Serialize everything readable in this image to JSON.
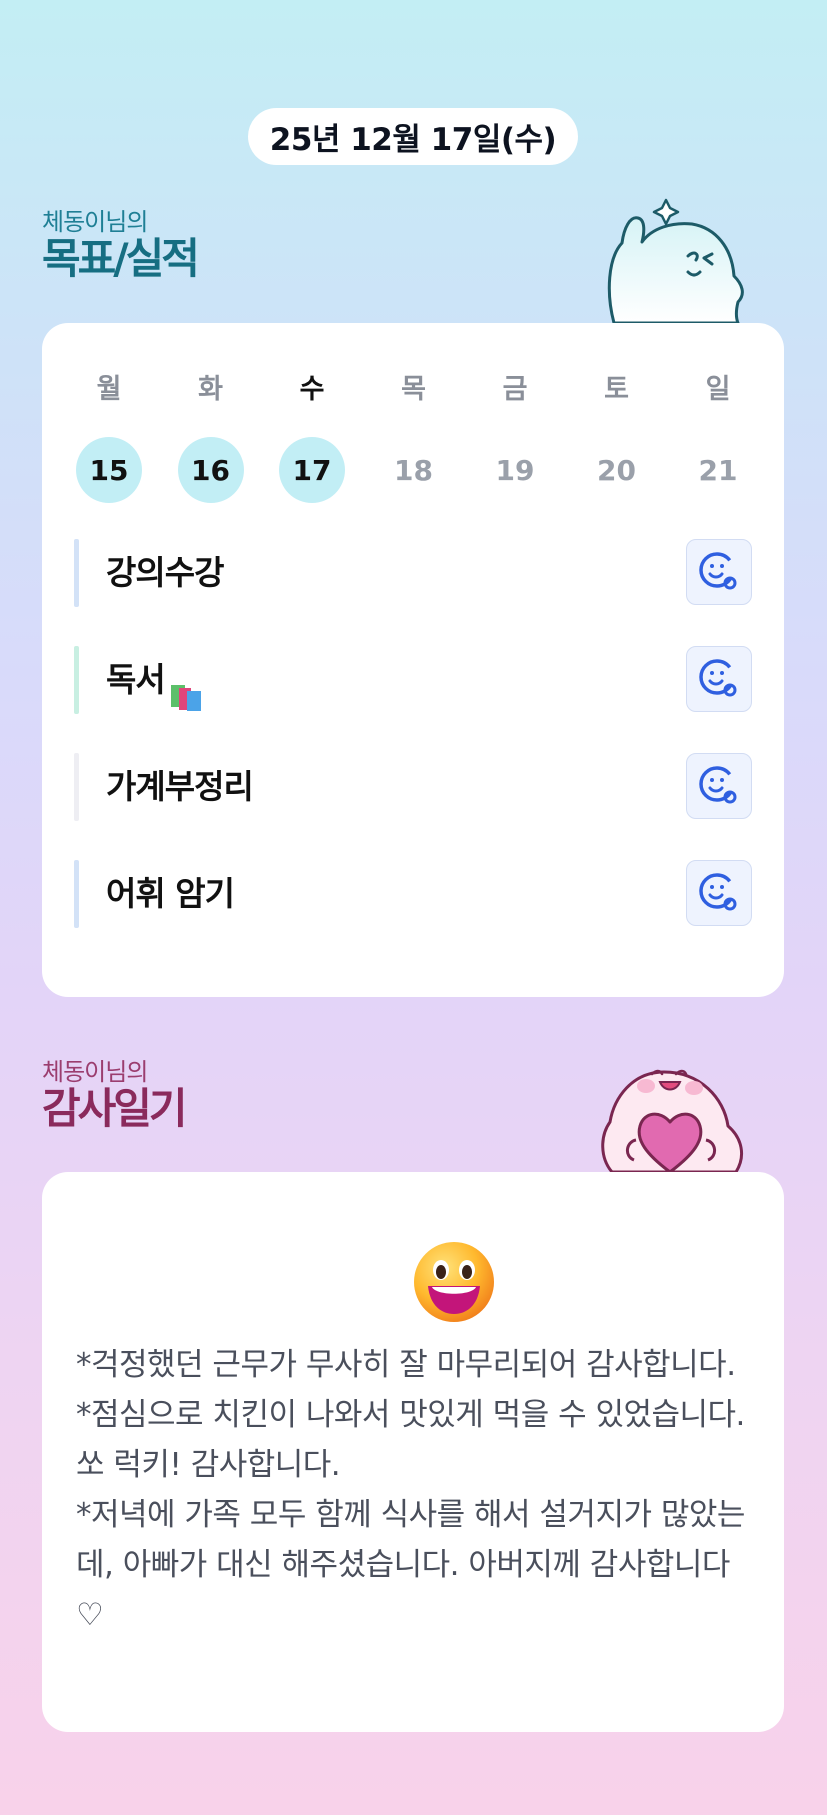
{
  "date_label": "25년 12월 17일(수)",
  "goals_section": {
    "subtitle": "체동이님의",
    "title": "목표/실적"
  },
  "week": [
    {
      "name": "월",
      "num": "15",
      "active": true,
      "today": false
    },
    {
      "name": "화",
      "num": "16",
      "active": true,
      "today": false
    },
    {
      "name": "수",
      "num": "17",
      "active": true,
      "today": true
    },
    {
      "name": "목",
      "num": "18",
      "active": false,
      "today": false
    },
    {
      "name": "금",
      "num": "19",
      "active": false,
      "today": false
    },
    {
      "name": "토",
      "num": "20",
      "active": false,
      "today": false
    },
    {
      "name": "일",
      "num": "21",
      "active": false,
      "today": false
    }
  ],
  "goals": [
    {
      "label": "강의수강",
      "bar_color": "#d3e2f7",
      "icon": "smile-face-icon"
    },
    {
      "label": "독서",
      "emoji": "books-icon",
      "bar_color": "#c8efe2",
      "icon": "smile-face-icon"
    },
    {
      "label": "가계부정리",
      "bar_color": "#eeeef3",
      "icon": "smile-face-icon"
    },
    {
      "label": "어휘 암기",
      "bar_color": "#d3e2f7",
      "icon": "smile-face-icon"
    }
  ],
  "diary_section": {
    "subtitle": "체동이님의",
    "title": "감사일기"
  },
  "diary": {
    "mood_icon": "grinning-face-icon",
    "text": "*걱정했던 근무가 무사히 잘 마무리되어 감사합니다.\n*점심으로 치킨이 나와서 맛있게 먹을 수 있었습니다. 쏘 럭키! 감사합니다.\n*저녁에 가족 모두 함께 식사를 해서 설거지가 많았는데, 아빠가 대신 해주셨습니다. 아버지께 감사합니다 ♡"
  },
  "colors": {
    "accent_teal": "#166e82",
    "accent_plum": "#8a2a5c",
    "day_active_bg": "#c2eef5",
    "icon_blue": "#2f5fe0"
  }
}
